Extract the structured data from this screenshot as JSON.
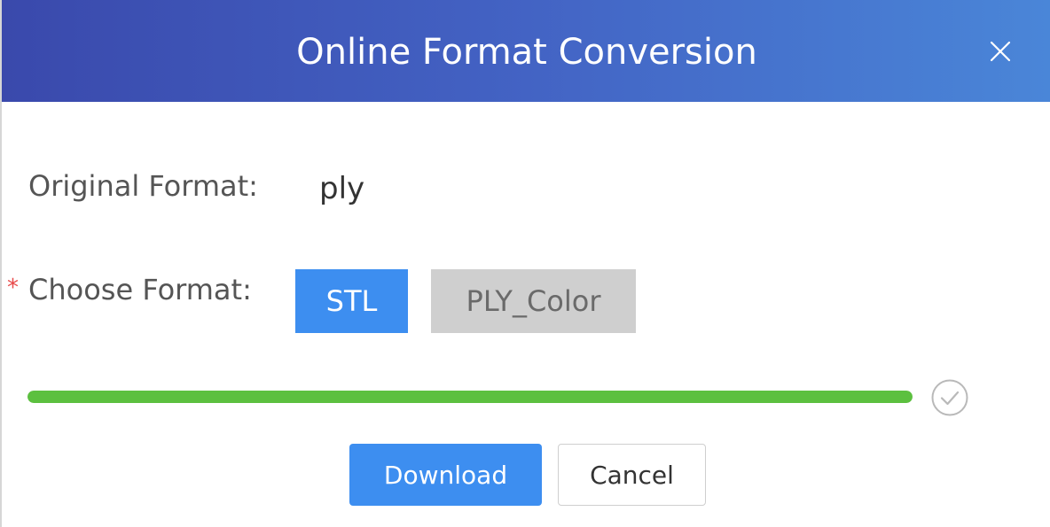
{
  "dialog": {
    "title": "Online Format Conversion",
    "close_icon": "close-icon"
  },
  "form": {
    "original_label": "Original Format:",
    "original_value": "ply",
    "choose_label": "Choose Format:",
    "required_marker": "*",
    "options": [
      {
        "label": "STL",
        "selected": true
      },
      {
        "label": "PLY_Color",
        "selected": false
      }
    ]
  },
  "progress": {
    "percent": 100,
    "status_icon": "check-circle-icon",
    "color": "#5cc03f"
  },
  "buttons": {
    "download_label": "Download",
    "cancel_label": "Cancel"
  },
  "colors": {
    "header_start": "#3a49ac",
    "header_end": "#4a86d8",
    "primary": "#3d8ef0",
    "required": "#e84a4a"
  }
}
